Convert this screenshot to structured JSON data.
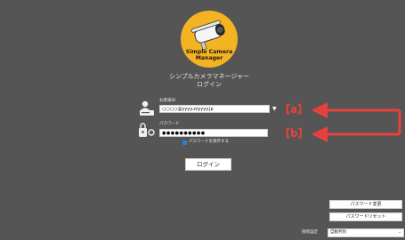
{
  "app": {
    "logo_line1": "Simple Camera",
    "logo_line2": "Manager",
    "title": "シンプルカメラマネージャー",
    "subtitle": "ログイン"
  },
  "form": {
    "username_label": "お客様ID",
    "username_value": "○○○○@yyyy.zzyyyy.jp",
    "password_label": "パスワード",
    "password_value": "●●●●●●●●●●",
    "remember_label": "パスワードを保存する",
    "remember_checked": true,
    "login_label": "ログイン"
  },
  "annotations": {
    "a": "【a】",
    "b": "【b】",
    "color": "#e8413b"
  },
  "side": {
    "change_password_label": "パスワード変更",
    "reset_password_label": "パスワードリセット",
    "language_label": "接続設定",
    "language_value": "自動判別"
  },
  "colors": {
    "background": "#555555",
    "logo_bg": "#f4b321",
    "checkbox": "#2f7fe0"
  },
  "icons": [
    "camera-logo-icon",
    "user-card-icon",
    "key-icon",
    "dropdown-arrow-icon"
  ]
}
